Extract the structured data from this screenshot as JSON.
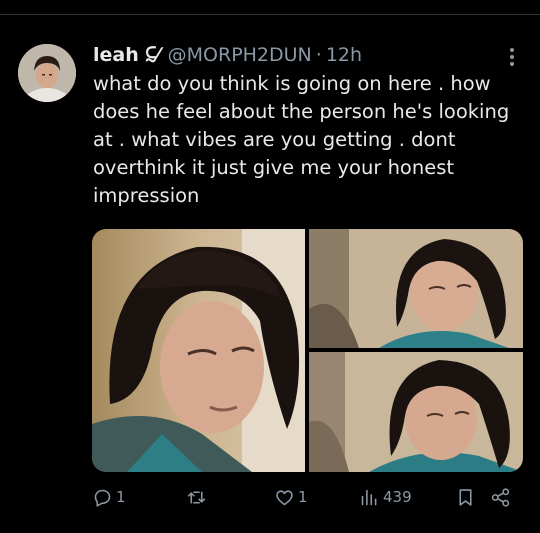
{
  "tweet": {
    "author_name": "leah ⫇⁄",
    "handle": "@MORPH2DUN",
    "separator": "·",
    "time": "12h",
    "text": "what do you think is going on here . how does he feel about the person he's looking at . what vibes are you getting . dont overthink it just give me your honest impression"
  },
  "actions": {
    "reply_count": "1",
    "retweet_count": "",
    "like_count": "1",
    "view_count": "439"
  },
  "icons": {
    "reply": "reply-icon",
    "retweet": "retweet-icon",
    "like": "heart-icon",
    "views": "views-chart-icon",
    "bookmark": "bookmark-icon",
    "share": "share-icon",
    "more": "more-options-icon"
  },
  "colors": {
    "background": "#000000",
    "text_primary": "#e7e9ea",
    "text_secondary": "#8b98a5"
  }
}
